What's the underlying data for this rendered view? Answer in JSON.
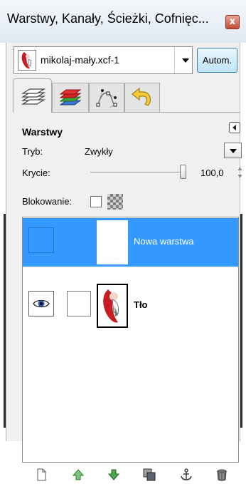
{
  "window": {
    "title": "Warstwy, Kanały, Ścieżki, Cofnięc...",
    "close_glyph": "x"
  },
  "image_selector": {
    "name": "mikolaj-mały.xcf-1",
    "autom_label": "Autom."
  },
  "tabs": [
    {
      "name": "layers-tab",
      "icon": "layers-icon"
    },
    {
      "name": "channels-tab",
      "icon": "channels-icon"
    },
    {
      "name": "paths-tab",
      "icon": "paths-icon"
    },
    {
      "name": "undo-history-tab",
      "icon": "undo-icon"
    }
  ],
  "layers_panel": {
    "heading": "Warstwy",
    "mode_label": "Tryb:",
    "mode_value": "Zwykły",
    "opacity_label": "Krycie:",
    "opacity_value": "100,0",
    "opacity_level": 1.0,
    "lock_label": "Blokowanie:"
  },
  "layers": [
    {
      "name": "Nowa warstwa",
      "selected": true,
      "visible": false
    },
    {
      "name": "Tło",
      "selected": false,
      "visible": true
    }
  ],
  "colors": {
    "selection": "#3399ff",
    "autom_button": "#bfe3f8",
    "close_button": "#c34b35"
  },
  "bottom_toolbar": [
    "new-layer-icon",
    "raise-layer-icon",
    "lower-layer-icon",
    "duplicate-layer-icon",
    "anchor-layer-icon",
    "delete-layer-icon"
  ]
}
